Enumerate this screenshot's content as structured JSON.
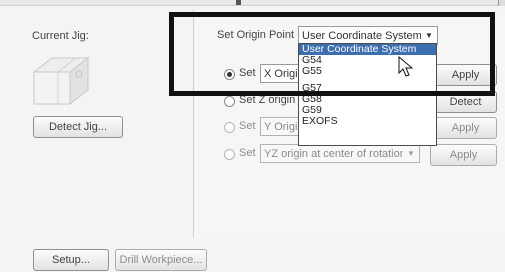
{
  "left": {
    "current_jig_label": "Current Jig:",
    "detect_jig_button": "Detect Jig...",
    "setup_button": "Setup...",
    "drill_workpiece_button": "Drill Workpiece..."
  },
  "origin": {
    "label": "Set Origin Point",
    "selected_value": "User Coordinate System",
    "options": [
      "User Coordinate System",
      "G54",
      "G55",
      "G57",
      "G58",
      "G59",
      "EXOFS"
    ],
    "highlighted_index": 0
  },
  "rows": [
    {
      "radio_label": "Set",
      "combo_value": "X Origin",
      "button": "Apply",
      "checked": true,
      "enabled": true
    },
    {
      "radio_label": "Set Z origin u",
      "combo_value": "",
      "button": "Detect",
      "checked": false,
      "enabled": true
    },
    {
      "radio_label": "Set",
      "combo_value": "Y Origin",
      "button": "Apply",
      "checked": false,
      "enabled": false
    },
    {
      "radio_label": "Set",
      "combo_value": "YZ origin at center of rotation",
      "button": "Apply",
      "checked": false,
      "enabled": false
    }
  ],
  "colors": {
    "selection": "#3d6fb0",
    "callout_border": "#111111"
  },
  "icons": {
    "jig": "jig-icon",
    "cursor": "mouse-pointer-icon",
    "dropdown": "chevron-down-icon"
  }
}
